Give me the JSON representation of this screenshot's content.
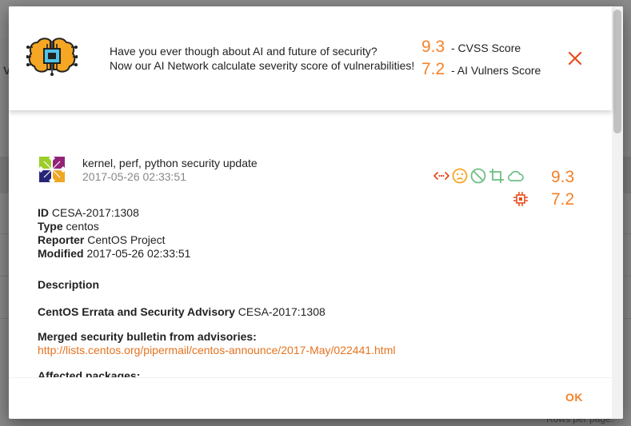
{
  "banner": {
    "line1": "Have you ever though about AI and future of security?",
    "line2": "Now our AI Network calculate severity score of vulnerabilities!",
    "cvss_value": "9.3",
    "cvss_label": "- CVSS Score",
    "ai_value": "7.2",
    "ai_label": "- AI Vulners Score"
  },
  "item": {
    "title": "kernel, perf, python security update",
    "date": "2017-05-26 02:33:51",
    "cvss_score": "9.3",
    "ai_score": "7.2",
    "icons": [
      "network-arrows-icon",
      "sad-face-icon",
      "block-icon",
      "crop-icon",
      "cloud-icon",
      "cpu-icon"
    ]
  },
  "meta": {
    "id_label": "ID",
    "id_value": "CESA-2017:1308",
    "type_label": "Type",
    "type_value": "centos",
    "reporter_label": "Reporter",
    "reporter_value": "CentOS Project",
    "modified_label": "Modified",
    "modified_value": "2017-05-26 02:33:51"
  },
  "description": {
    "heading": "Description",
    "advisory_bold": "CentOS Errata and Security Advisory",
    "advisory_id": "CESA-2017:1308",
    "merged_heading": "Merged security bulletin from advisories:",
    "link": "http://lists.centos.org/pipermail/centos-announce/2017-May/022441.html",
    "affected_heading": "Affected packages:"
  },
  "footer": {
    "ok_label": "OK"
  },
  "background": {
    "rows_per_page": "Rows per page:"
  },
  "colors": {
    "accent": "#f4822a",
    "link": "#e5731f",
    "icon_green": "#6cbf84",
    "icon_orange": "#f5a623",
    "icon_red": "#e84c1c"
  }
}
